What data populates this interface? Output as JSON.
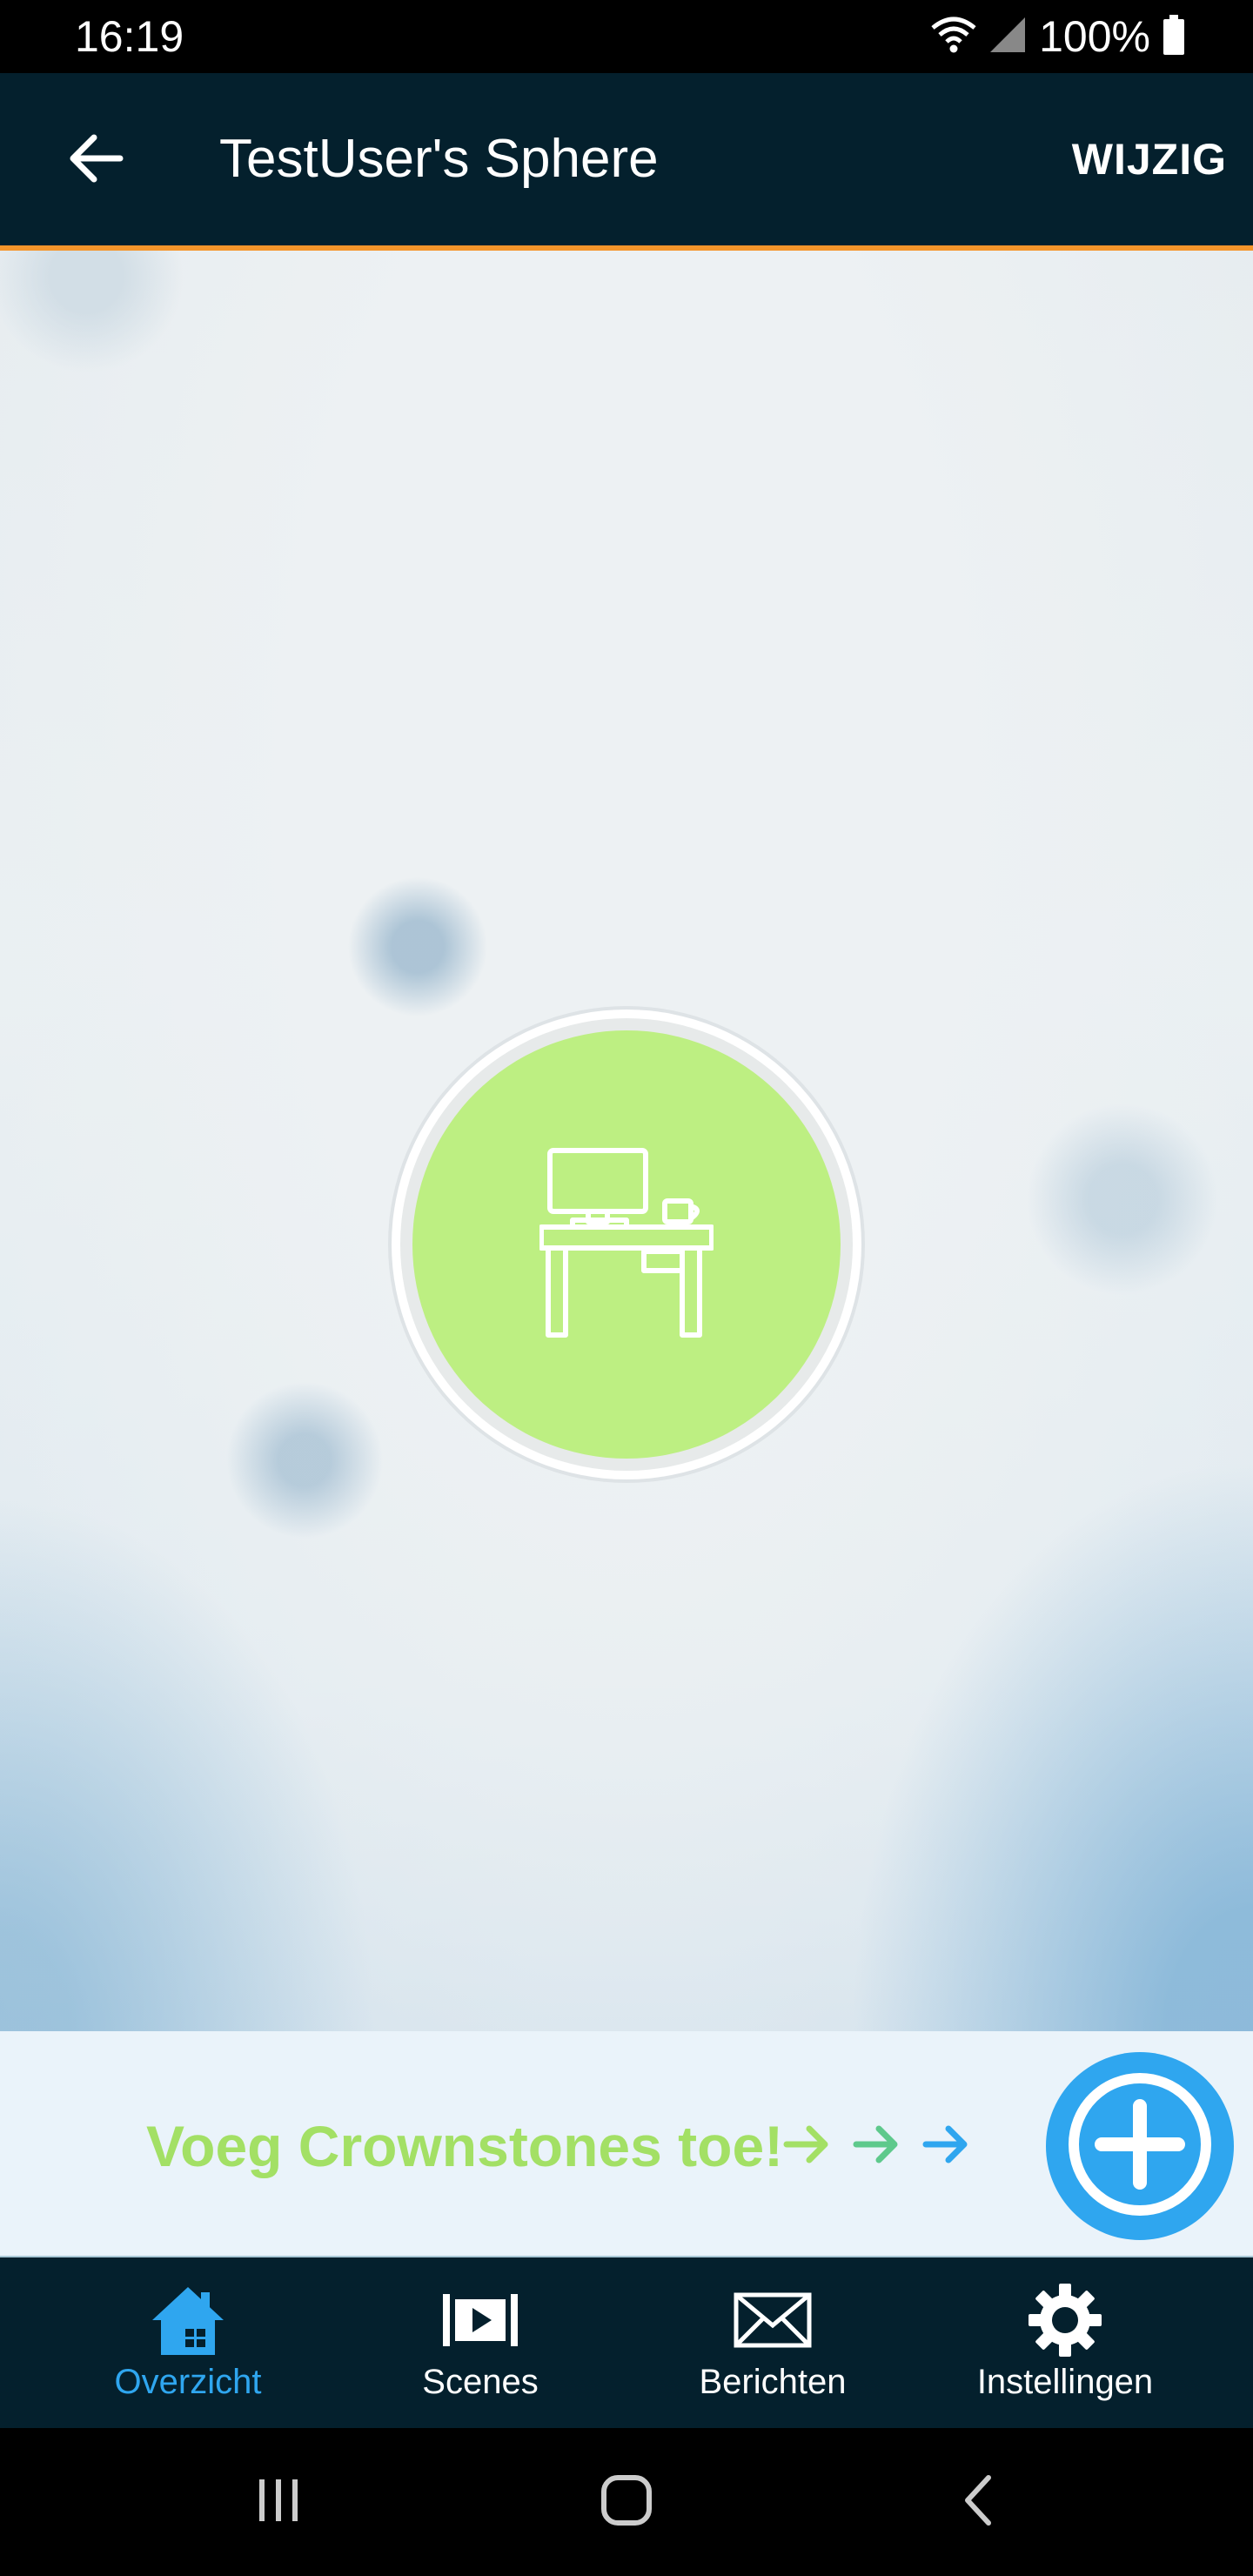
{
  "status_bar": {
    "time": "16:19",
    "battery": "100%"
  },
  "app_bar": {
    "title": "TestUser's Sphere",
    "edit_label": "WIJZIG"
  },
  "room": {
    "icon": "desk-icon",
    "color": "#bdef82"
  },
  "cta": {
    "text": "Voeg Crownstones toe!",
    "arrow_colors": [
      "#a3e065",
      "#5ec98c",
      "#2fa6ef"
    ]
  },
  "tabs": [
    {
      "label": "Overzicht",
      "icon": "home-icon",
      "active": true
    },
    {
      "label": "Scenes",
      "icon": "scenes-icon",
      "active": false
    },
    {
      "label": "Berichten",
      "icon": "envelope-icon",
      "active": false
    },
    {
      "label": "Instellingen",
      "icon": "gear-icon",
      "active": false
    }
  ],
  "colors": {
    "accent": "#f5952b",
    "primary": "#04202d",
    "active_tab": "#2fa6ef",
    "add_button": "#2fa6ef"
  }
}
